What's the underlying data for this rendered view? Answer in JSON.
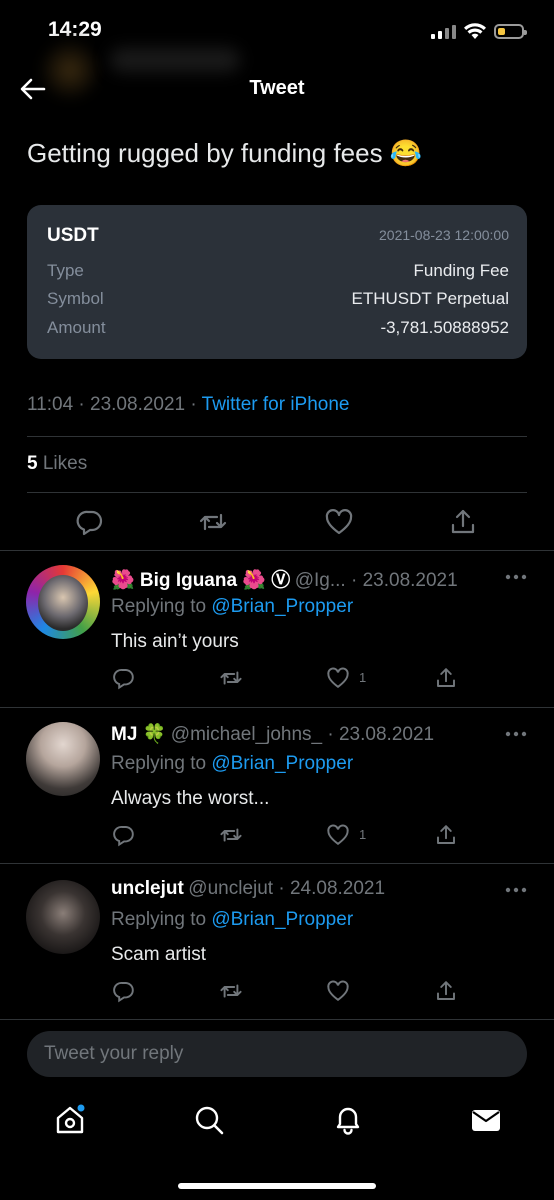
{
  "status": {
    "time": "14:29"
  },
  "header": {
    "title": "Tweet"
  },
  "tweet": {
    "text": "Getting rugged by funding fees 😂",
    "card": {
      "title": "USDT",
      "date": "2021-08-23 12:00:00",
      "rows": [
        {
          "label": "Type",
          "value": "Funding Fee"
        },
        {
          "label": "Symbol",
          "value": "ETHUSDT Perpetual"
        },
        {
          "label": "Amount",
          "value": "-3,781.50888952"
        }
      ]
    },
    "time": "11:04 · 23.08.2021 · ",
    "source": "Twitter for iPhone",
    "likes_count": "5",
    "likes_label": " Likes"
  },
  "replies": [
    {
      "name": "🌺 Big Iguana 🌺 Ⓥ",
      "handle": "@Ig... · 23.08.2021",
      "replying_prefix": "Replying to ",
      "replying_user": "@Brian_Propper",
      "text": "This ain’t yours",
      "likes": "1"
    },
    {
      "name": "MJ 🍀",
      "handle": "@michael_johns_ · 23.08.2021",
      "replying_prefix": "Replying to ",
      "replying_user": "@Brian_Propper",
      "text": "Always the worst...",
      "likes": "1"
    },
    {
      "name": "unclejut",
      "handle": "@unclejut · 24.08.2021",
      "replying_prefix": "Replying to ",
      "replying_user": "@Brian_Propper",
      "text": "Scam artist",
      "likes": ""
    }
  ],
  "compose": {
    "placeholder": "Tweet your reply"
  },
  "tabs": [
    "home-icon",
    "search-icon",
    "bell-icon",
    "mail-icon"
  ],
  "colors": {
    "accent": "#1d9bf0",
    "card_bg": "#2b3139",
    "background": "#000000"
  }
}
